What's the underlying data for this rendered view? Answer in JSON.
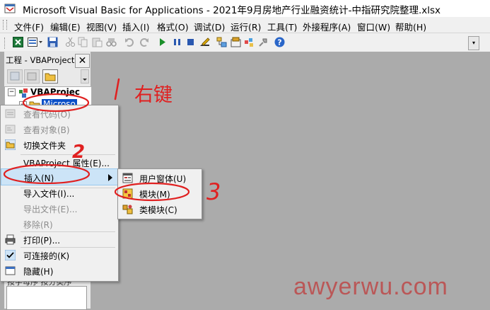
{
  "window": {
    "title": "Microsoft Visual Basic for Applications - 2021年9月房地产行业融资统计-中指研究院整理.xlsx"
  },
  "menubar": {
    "items": [
      "文件(F)",
      "编辑(E)",
      "视图(V)",
      "插入(I)",
      "格式(O)",
      "调试(D)",
      "运行(R)",
      "工具(T)",
      "外接程序(A)",
      "窗口(W)",
      "帮助(H)"
    ]
  },
  "toolbar": {
    "icons": [
      "excel-icon",
      "insert-module-icon",
      "save-icon",
      "cut-icon",
      "copy-icon",
      "paste-icon",
      "find-icon",
      "undo-icon",
      "redo-icon",
      "run-icon",
      "break-icon",
      "reset-icon",
      "design-mode-icon",
      "project-explorer-icon",
      "properties-icon",
      "object-browser-icon",
      "toolbox-icon",
      "help-icon"
    ]
  },
  "project_window": {
    "title": "工程 - VBAProject",
    "close_label": "✕",
    "tree": {
      "root": "VBAProjec",
      "child": "Microso"
    },
    "props_header": "按字母序  按分类序"
  },
  "context_menu": {
    "items": [
      {
        "label": "查看代码(O)",
        "enabled": false
      },
      {
        "label": "查看对象(B)",
        "enabled": false
      },
      {
        "label": "切换文件夹",
        "enabled": true
      },
      {
        "label": "VBAProject 属性(E)...",
        "enabled": true
      },
      {
        "label": "插入(N)",
        "enabled": true
      },
      {
        "label": "导入文件(I)...",
        "enabled": true
      },
      {
        "label": "导出文件(E)...",
        "enabled": false
      },
      {
        "label": "移除(R)",
        "enabled": false
      },
      {
        "label": "打印(P)...",
        "enabled": true
      },
      {
        "label": "可连接的(K)",
        "enabled": true
      },
      {
        "label": "隐藏(H)",
        "enabled": true
      }
    ]
  },
  "submenu": {
    "items": [
      "用户窗体(U)",
      "模块(M)",
      "类模块(C)"
    ]
  },
  "annotations": {
    "step1_text": "右键",
    "step2_mark": "2",
    "step3_mark": "3",
    "color": "#e02020"
  },
  "watermark": "awyerwu.com"
}
